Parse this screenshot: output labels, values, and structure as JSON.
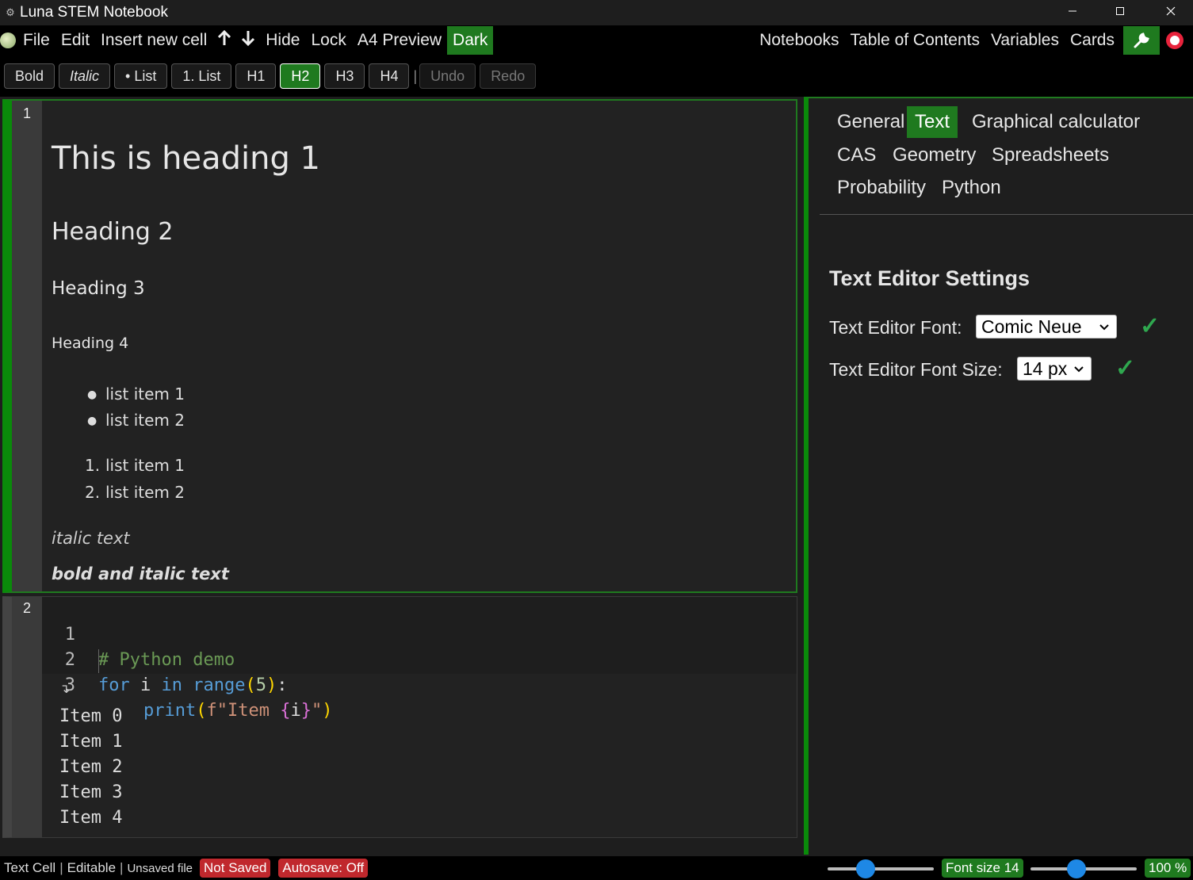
{
  "window": {
    "title": "Luna STEM Notebook",
    "controls": {
      "minimize": "—",
      "maximize": "☐",
      "close": "✕"
    }
  },
  "menubar": {
    "left": [
      "File",
      "Edit",
      "Insert new cell",
      "Hide",
      "Lock",
      "A4 Preview",
      "Dark"
    ],
    "right": [
      "Notebooks",
      "Table of Contents",
      "Variables",
      "Cards"
    ],
    "active": "Dark",
    "accent": "#1f7a1f"
  },
  "toolbar": {
    "buttons": [
      "Bold",
      "Italic",
      "• List",
      "1. List",
      "H1",
      "H2",
      "H3",
      "H4"
    ],
    "active": "H2",
    "separator": "|",
    "undo": "Undo",
    "redo": "Redo"
  },
  "cell1": {
    "number": "1",
    "heading1": "This is heading 1",
    "heading2": "Heading 2",
    "heading3": "Heading 3",
    "heading4": "Heading 4",
    "bullet_items": [
      "list item 1",
      "list item 2"
    ],
    "ordered_items": [
      "list item 1",
      "list item 2"
    ],
    "ordered_markers": [
      "1.",
      "2."
    ],
    "italic_text": "italic text",
    "bold_italic_text": "bold and italic text"
  },
  "cell2": {
    "number": "2",
    "code_line_numbers": [
      "1",
      "2",
      "3"
    ],
    "code": {
      "line1": "# Python demo",
      "line2_kw1": "for",
      "line2_var": " i ",
      "line2_kw2": "in",
      "line2_fn": " range",
      "line2_open": "(",
      "line2_num": "5",
      "line2_close": ")",
      "line2_colon": ":",
      "line3_fn": "print",
      "line3_open": "(",
      "line3_str1": "f\"Item ",
      "line3_brace_open": "{",
      "line3_var": "i",
      "line3_brace_close": "}",
      "line3_str2": "\"",
      "line3_close": ")"
    },
    "output_marker": "↴",
    "output": [
      "Item 0",
      "Item 1",
      "Item 2",
      "Item 3",
      "Item 4"
    ]
  },
  "settings": {
    "tabs_row1": [
      "General",
      "Text",
      "Graphical calculator"
    ],
    "tabs_row2": [
      "CAS",
      "Geometry",
      "Spreadsheets"
    ],
    "tabs_row3": [
      "Probability",
      "Python"
    ],
    "active_tab": "Text",
    "title": "Text Editor Settings",
    "font_label": "Text Editor Font:",
    "font_value": "Comic Neue",
    "size_label": "Text Editor Font Size:",
    "size_value": "14 px",
    "check": "✓",
    "chevron": "⌄"
  },
  "statusbar": {
    "cell_type": "Text Cell",
    "editable": "Editable",
    "file": "Unsaved file",
    "saved": "Not Saved",
    "autosave": "Autosave: Off",
    "font_size": "Font size 14",
    "zoom": "100 %",
    "sep": "|",
    "status_red": "#c0282d",
    "status_green": "#1f7a1f"
  }
}
